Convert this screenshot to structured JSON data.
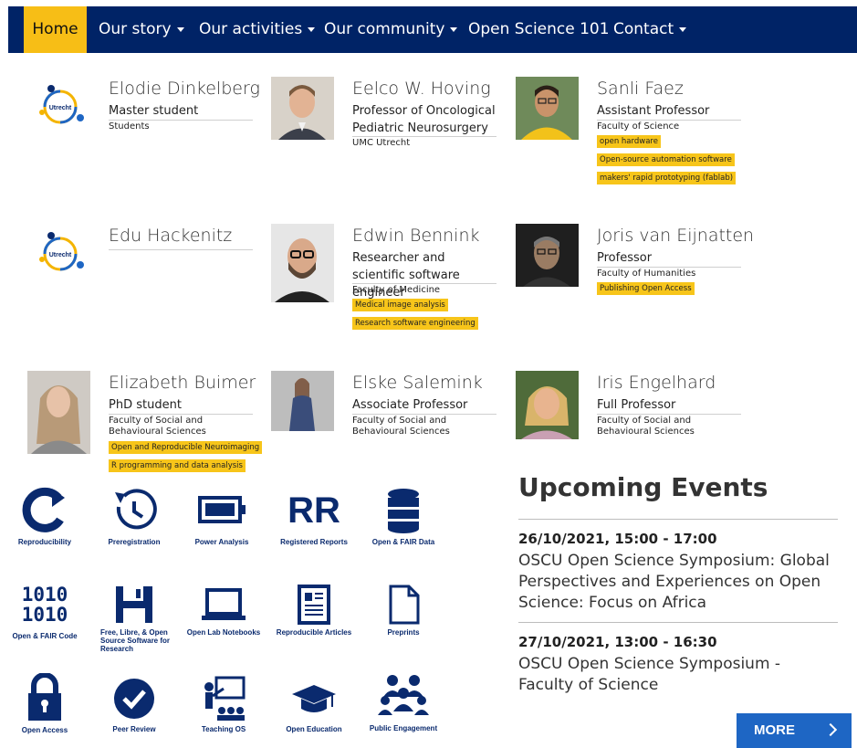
{
  "nav": {
    "items": [
      {
        "label": "Home",
        "active": true
      },
      {
        "label": "Our story",
        "dropdown": true
      },
      {
        "label": "Our activities",
        "dropdown": true
      },
      {
        "label": "Our community",
        "dropdown": true
      },
      {
        "label": "Open Science 101",
        "dropdown": false
      },
      {
        "label": "Contact",
        "dropdown": true
      }
    ]
  },
  "people": [
    {
      "name": "Elodie Dinkelberg",
      "role": "Master student",
      "dept": "Students",
      "tags": [],
      "photo": "utrecht-logo"
    },
    {
      "name": "Eelco W. Hoving",
      "role": "Professor of Oncological Pediatric Neurosurgery",
      "dept": "UMC Utrecht",
      "tags": [],
      "photo": "portrait"
    },
    {
      "name": "Sanli Faez",
      "role": "Assistant Professor",
      "dept": "Faculty of Science",
      "tags": [
        "open hardware",
        "Open-source automation software",
        "makers' rapid prototyping (fablab)"
      ],
      "photo": "portrait"
    },
    {
      "name": "Edu Hackenitz",
      "role": "",
      "dept": "",
      "tags": [],
      "photo": "utrecht-logo"
    },
    {
      "name": "Edwin Bennink",
      "role": "Researcher and scientific software engineer",
      "dept": "Faculty of Medicine",
      "tags": [
        "Medical image analysis",
        "Research software engineering"
      ],
      "photo": "portrait"
    },
    {
      "name": "Joris van Eijnatten",
      "role": "Professor",
      "dept": "Faculty of Humanities",
      "tags": [
        "Publishing Open Access"
      ],
      "photo": "portrait"
    },
    {
      "name": "Elizabeth Buimer",
      "role": "PhD student",
      "dept": "Faculty of Social and Behavioural Sciences",
      "tags": [
        "Open and Reproducible Neuroimaging",
        "R programming and data analysis"
      ],
      "photo": "portrait"
    },
    {
      "name": "Elske Salemink",
      "role": "Associate Professor",
      "dept": "Faculty of Social and Behavioural Sciences",
      "tags": [],
      "photo": "portrait"
    },
    {
      "name": "Iris Engelhard",
      "role": "Full Professor",
      "dept": "Faculty of Social and Behavioural Sciences",
      "tags": [],
      "photo": "portrait"
    }
  ],
  "logo_text": "Utrecht",
  "icons": [
    {
      "label": "Reproducibility",
      "icon": "reproducibility-icon"
    },
    {
      "label": "Preregistration",
      "icon": "preregistration-icon"
    },
    {
      "label": "Power Analysis",
      "icon": "battery-icon"
    },
    {
      "label": "Registered Reports",
      "icon": "rr-icon",
      "glyph": "RR"
    },
    {
      "label": "Open & FAIR Data",
      "icon": "database-icon"
    },
    {
      "label": "Open & FAIR Code",
      "icon": "binary-code-icon",
      "glyph": "1010\n1010"
    },
    {
      "label": "Free, Libre, & Open Source Software for Research",
      "icon": "floppy-disk-icon"
    },
    {
      "label": "Open Lab Notebooks",
      "icon": "laptop-icon"
    },
    {
      "label": "Reproducible Articles",
      "icon": "newspaper-icon"
    },
    {
      "label": "Preprints",
      "icon": "document-icon"
    },
    {
      "label": "Open Access",
      "icon": "padlock-icon"
    },
    {
      "label": "Peer Review",
      "icon": "checkmark-icon"
    },
    {
      "label": "Teaching OS",
      "icon": "teaching-icon"
    },
    {
      "label": "Open Education",
      "icon": "graduation-cap-icon"
    },
    {
      "label": "Public Engagement",
      "icon": "people-group-icon"
    }
  ],
  "events": {
    "title": "Upcoming Events",
    "items": [
      {
        "date": "26/10/2021, 15:00 - 17:00",
        "title": "OSCU Open Science Symposium: Global Perspectives and Experiences on Open Science: Focus on Africa"
      },
      {
        "date": "27/10/2021, 13:00 - 16:30",
        "title": "OSCU Open Science Symposium - Faculty of Science"
      }
    ],
    "more_label": "MORE"
  },
  "colors": {
    "navy": "#002366",
    "accent": "#f7be16",
    "tag": "#f7c51a",
    "button": "#1e66c4",
    "icon": "#0a2a6e"
  }
}
